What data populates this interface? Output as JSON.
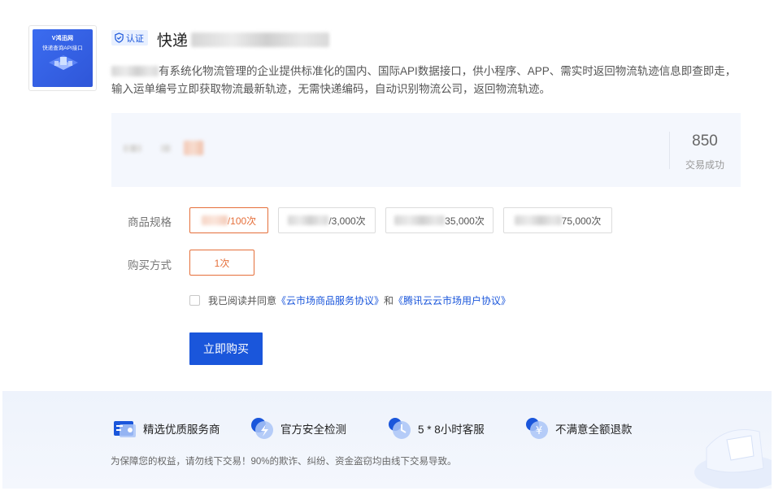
{
  "product": {
    "thumbnail_logo": "V鸿迅网",
    "thumbnail_caption": "快递查询API接口",
    "badge": "认证",
    "title_prefix": "快递",
    "description_rest": "有系统化物流管理的企业提供标准化的国内、国际API数据接口，供小程序、APP、需实时返回物流轨迹信息即查即走，输入运单编号立即获取物流最新轨迹，无需快递编码，自动识别物流公司，返回物流轨迹。"
  },
  "stats": {
    "value": "850",
    "label": "交易成功"
  },
  "spec": {
    "label": "商品规格",
    "options": [
      {
        "suffix": "/100次",
        "selected": true
      },
      {
        "suffix": "/3,000次",
        "selected": false
      },
      {
        "suffix": "35,000次",
        "selected": false
      },
      {
        "suffix": "75,000次",
        "selected": false
      }
    ]
  },
  "purchase": {
    "label": "购买方式",
    "option": "1次"
  },
  "agreement": {
    "prefix": "我已阅读并同意",
    "link1": "《云市场商品服务协议》",
    "and": "和",
    "link2": "《腾讯云云市场用户协议》"
  },
  "buy_button": "立即购买",
  "guarantees": [
    {
      "icon": "verified-provider-icon",
      "label": "精选优质服务商"
    },
    {
      "icon": "security-check-icon",
      "label": "官方安全检测"
    },
    {
      "icon": "clock-icon",
      "label": "5 * 8小时客服"
    },
    {
      "icon": "refund-icon",
      "label": "不满意全额退款"
    }
  ],
  "footer_note": "为保障您的权益，请勿线下交易！90%的欺诈、纠纷、资金盗窃均由线下交易导致。",
  "colors": {
    "primary": "#1a56db",
    "selected": "#e56f3a",
    "stats_bg": "#f4f7fd"
  }
}
